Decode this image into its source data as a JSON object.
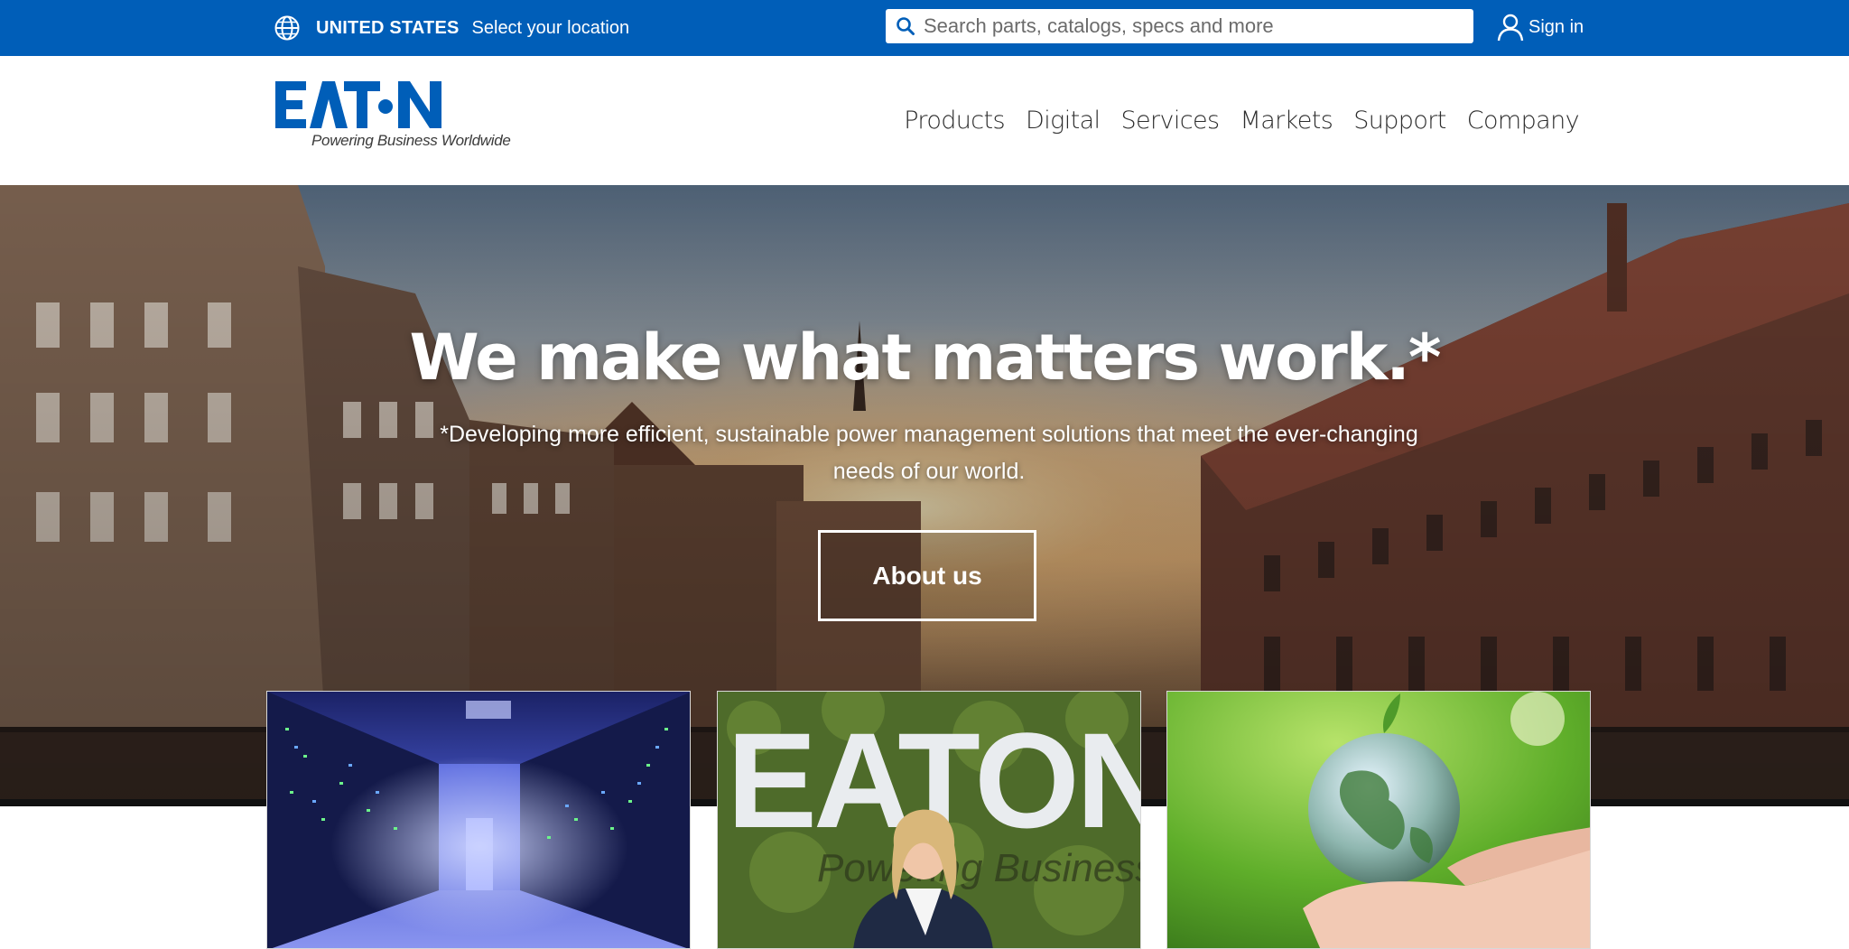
{
  "topbar": {
    "country": "UNITED STATES",
    "select_location": "Select your location",
    "search_placeholder": "Search parts, catalogs, specs and more",
    "sign_in": "Sign in"
  },
  "brand": {
    "logo_text": "EATON",
    "tagline": "Powering Business Worldwide",
    "color": "#005eb8"
  },
  "nav": {
    "items": [
      {
        "label": "Products"
      },
      {
        "label": "Digital"
      },
      {
        "label": "Services"
      },
      {
        "label": "Markets"
      },
      {
        "label": "Support"
      },
      {
        "label": "Company"
      }
    ]
  },
  "hero": {
    "title": "We make what matters work.*",
    "subtitle": "*Developing more efficient, sustainable power management solutions that meet the ever-changing needs of our world.",
    "button": "About us"
  },
  "cards": [
    {
      "image": "data-center-server-room"
    },
    {
      "image": "eaton-moss-wall-woman-portrait",
      "logo_text": "EATON",
      "wall_text": "Powering Business"
    },
    {
      "image": "glass-globe-in-hands"
    }
  ],
  "icons": {
    "globe": "globe-icon",
    "search": "search-icon",
    "user": "user-icon"
  }
}
